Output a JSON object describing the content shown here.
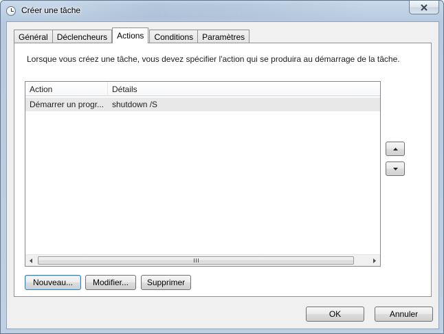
{
  "window": {
    "title": "Créer une tâche",
    "close_icon": "close-icon",
    "title_icon": "clock-icon"
  },
  "tabs": [
    {
      "label": "Général",
      "active": false
    },
    {
      "label": "Déclencheurs",
      "active": false
    },
    {
      "label": "Actions",
      "active": true
    },
    {
      "label": "Conditions",
      "active": false
    },
    {
      "label": "Paramètres",
      "active": false
    }
  ],
  "actions_page": {
    "intro": "Lorsque vous créez une tâche, vous devez spécifier l'action qui se produira au démarrage de la tâche.",
    "columns": [
      "Action",
      "Détails"
    ],
    "rows": [
      {
        "action": "Démarrer un progr...",
        "details": "shutdown /S",
        "selected": true
      }
    ],
    "buttons": {
      "new": "Nouveau...",
      "edit": "Modifier...",
      "delete": "Supprimer"
    },
    "move_up_icon": "arrow-up-icon",
    "move_down_icon": "arrow-down-icon"
  },
  "footer": {
    "ok": "OK",
    "cancel": "Annuler"
  },
  "colors": {
    "selected_row": "#e8e8e8",
    "default_button_border": "#3c7fb1"
  }
}
